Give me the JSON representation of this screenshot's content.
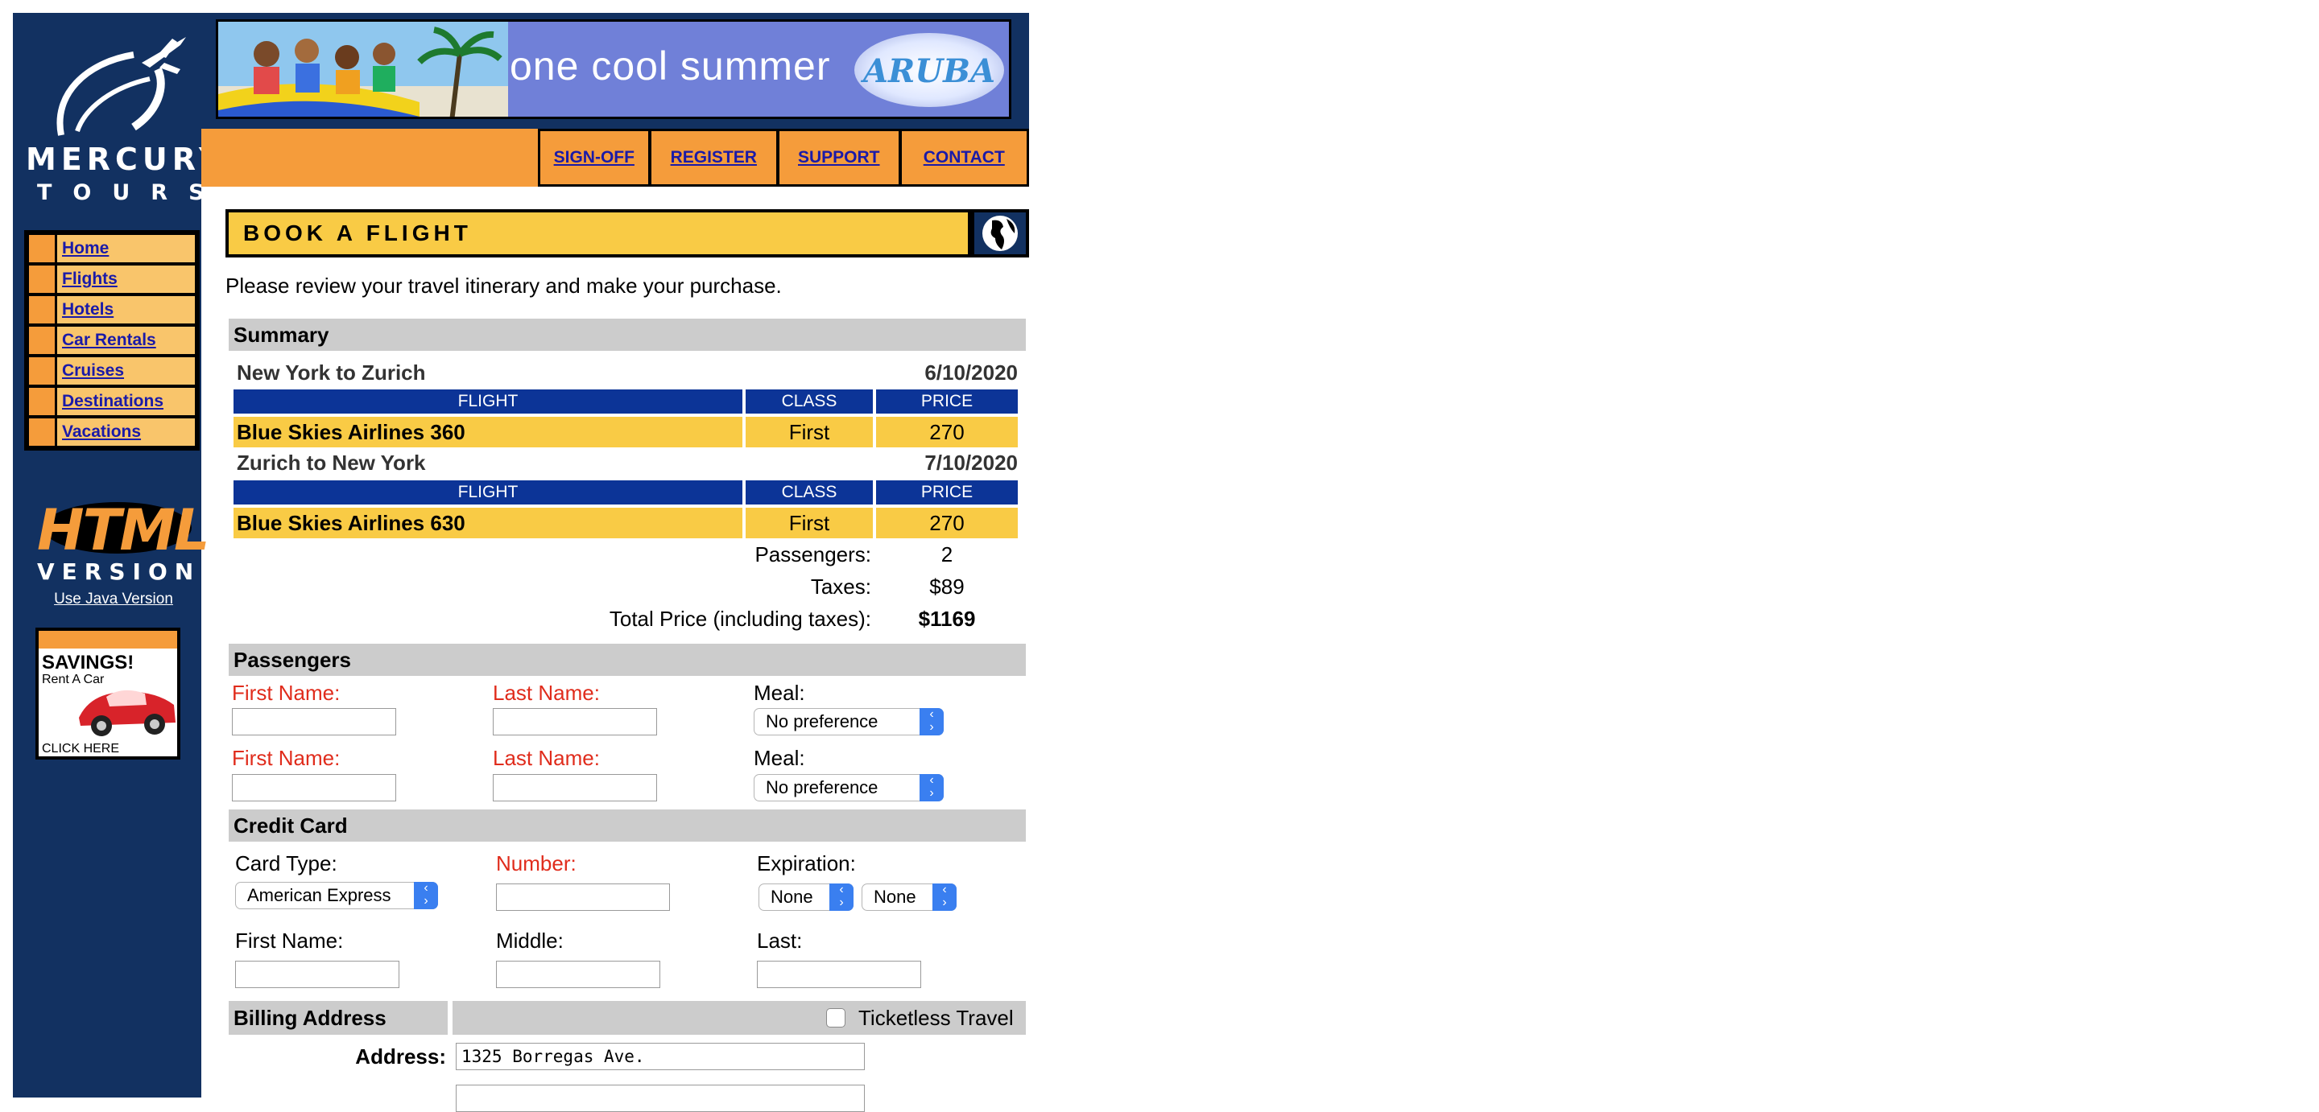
{
  "brand": {
    "line1": "MERCURY",
    "line2": "TOURS"
  },
  "sidebar": {
    "items": [
      {
        "label": "Home"
      },
      {
        "label": "Flights"
      },
      {
        "label": "Hotels"
      },
      {
        "label": "Car Rentals"
      },
      {
        "label": "Cruises"
      },
      {
        "label": "Destinations"
      },
      {
        "label": "Vacations"
      }
    ],
    "html_badge": "HTML",
    "version_badge": "VERSION",
    "java_link": "Use Java Version",
    "savings": {
      "title": "SAVINGS!",
      "subtitle": "Rent A Car",
      "cta": "CLICK HERE"
    }
  },
  "banner": {
    "tagline": "one cool summer",
    "logo_text": "ARUBA"
  },
  "topnav": [
    {
      "label": "SIGN-OFF"
    },
    {
      "label": "REGISTER"
    },
    {
      "label": "SUPPORT"
    },
    {
      "label": "CONTACT"
    }
  ],
  "page": {
    "title": "BOOK A FLIGHT",
    "intro": "Please review your travel itinerary and make your purchase."
  },
  "summary": {
    "heading": "Summary",
    "legs": [
      {
        "route": "New York to Zurich",
        "date": "6/10/2020",
        "headers": [
          "FLIGHT",
          "CLASS",
          "PRICE"
        ],
        "flight": "Blue Skies Airlines 360",
        "class": "First",
        "price": "270"
      },
      {
        "route": "Zurich to New York",
        "date": "7/10/2020",
        "headers": [
          "FLIGHT",
          "CLASS",
          "PRICE"
        ],
        "flight": "Blue Skies Airlines 630",
        "class": "First",
        "price": "270"
      }
    ],
    "passengers_label": "Passengers:",
    "passengers_value": "2",
    "taxes_label": "Taxes:",
    "taxes_value": "$89",
    "total_label": "Total Price (including taxes):",
    "total_value": "$1169"
  },
  "passengers": {
    "heading": "Passengers",
    "rows": [
      {
        "first_label": "First Name:",
        "last_label": "Last Name:",
        "meal_label": "Meal:",
        "meal_value": "No preference"
      },
      {
        "first_label": "First Name:",
        "last_label": "Last Name:",
        "meal_label": "Meal:",
        "meal_value": "No preference"
      }
    ]
  },
  "credit_card": {
    "heading": "Credit Card",
    "card_type_label": "Card Type:",
    "card_type_value": "American Express",
    "number_label": "Number:",
    "expiration_label": "Expiration:",
    "exp_month_value": "None",
    "exp_year_value": "None",
    "first_label": "First Name:",
    "middle_label": "Middle:",
    "last_label": "Last:"
  },
  "billing": {
    "heading": "Billing Address",
    "ticketless_label": "Ticketless Travel",
    "address_label": "Address:",
    "address_value": "1325 Borregas Ave."
  },
  "colors": {
    "sidebar_bg": "#123161",
    "accent_orange": "#f59c3b",
    "accent_yellow": "#f9cb45",
    "table_header": "#0c3497",
    "required_red": "#e02c1c",
    "link_blue": "#1a1aa8"
  }
}
